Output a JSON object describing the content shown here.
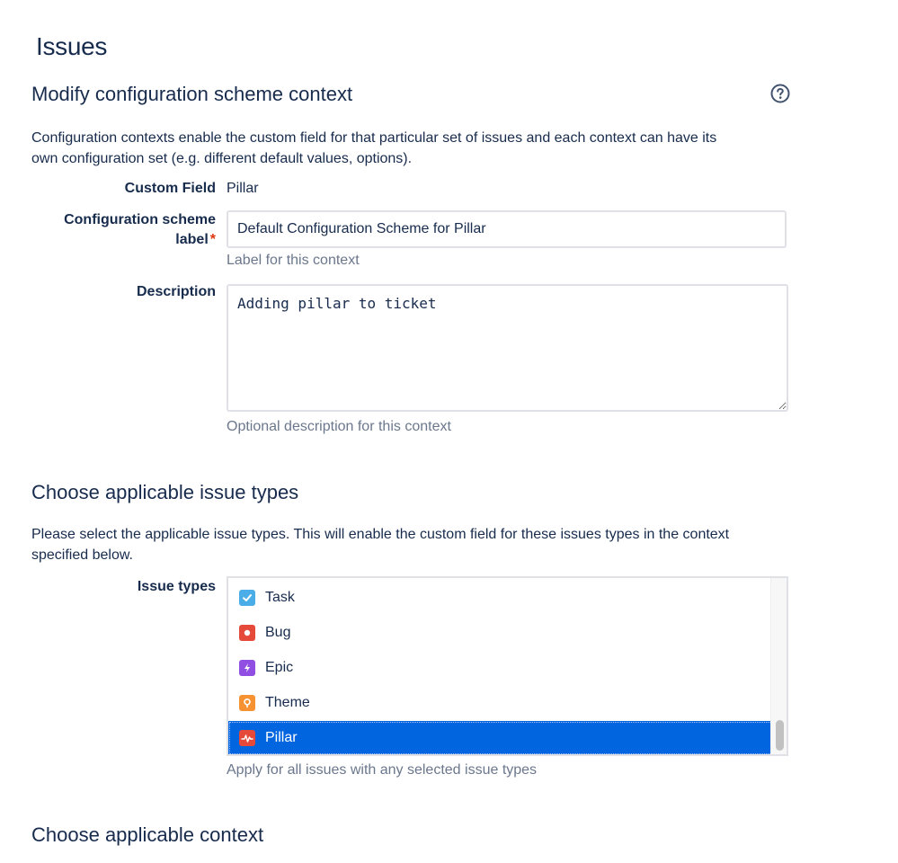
{
  "page": {
    "title": "Issues"
  },
  "context_section": {
    "title": "Modify configuration scheme context",
    "description_line1": "Configuration contexts enable the custom field for that particular set of issues and each context can have its",
    "description_line2": "own configuration set (e.g. different default values, options).",
    "help_icon": "question-circle-icon"
  },
  "form": {
    "custom_field_label": "Custom Field",
    "custom_field_value": "Pillar",
    "scheme_label_line1": "Configuration scheme",
    "scheme_label_line2": "label",
    "required_marker": "*",
    "scheme_label_value": "Default Configuration Scheme for Pillar",
    "scheme_label_hint": "Label for this context",
    "description_label": "Description",
    "description_value": "Adding pillar to ticket",
    "description_hint": "Optional description for this context"
  },
  "issue_types_section": {
    "title": "Choose applicable issue types",
    "description_line1": "Please select the applicable issue types. This will enable the custom field for these issues types in the context",
    "description_line2": "specified below.",
    "field_label": "Issue types",
    "options": [
      {
        "label": "Task",
        "icon": "task-icon",
        "color": "#4bade8",
        "selected": false
      },
      {
        "label": "Bug",
        "icon": "bug-icon",
        "color": "#e5493a",
        "selected": false
      },
      {
        "label": "Epic",
        "icon": "epic-icon",
        "color": "#904ee2",
        "selected": false
      },
      {
        "label": "Theme",
        "icon": "theme-icon",
        "color": "#f79232",
        "selected": false
      },
      {
        "label": "Pillar",
        "icon": "pillar-icon",
        "color": "#e5493a",
        "selected": true
      }
    ],
    "hint": "Apply for all issues with any selected issue types"
  },
  "context_choice_section": {
    "title": "Choose applicable context"
  },
  "colors": {
    "text": "#172b4d",
    "muted": "#6b778c",
    "required": "#de350b",
    "selection": "#0065de",
    "border": "#dfe1e6"
  }
}
